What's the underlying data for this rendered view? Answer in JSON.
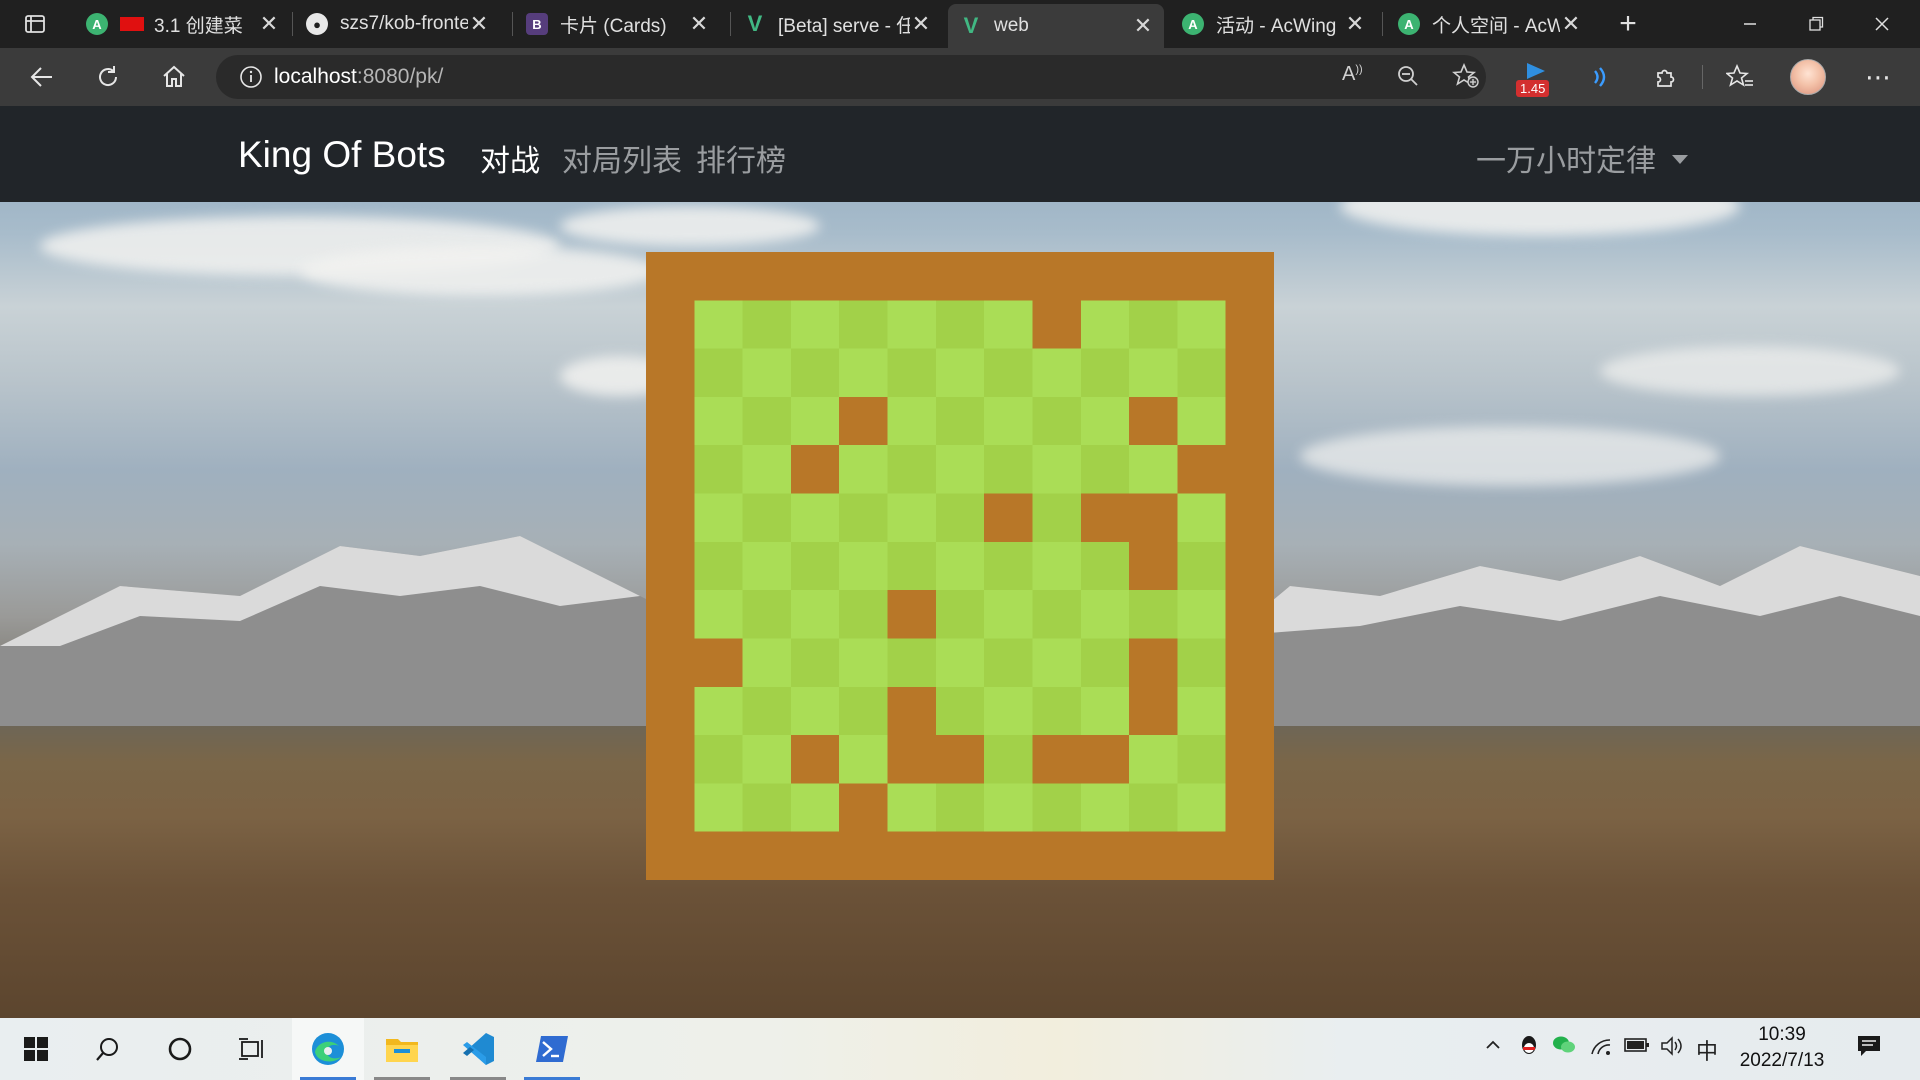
{
  "browser": {
    "tabs": [
      {
        "title": "3.1 创建菜",
        "favicon": "acwing-icon",
        "active": false
      },
      {
        "title": "szs7/kob-fronte",
        "favicon": "github-icon",
        "active": false
      },
      {
        "title": "卡片 (Cards)",
        "favicon": "bootstrap-icon",
        "active": false
      },
      {
        "title": "[Beta] serve - 任",
        "favicon": "vue-icon",
        "active": false
      },
      {
        "title": "web",
        "favicon": "vue-icon",
        "active": true
      },
      {
        "title": "活动 - AcWing",
        "favicon": "acwing-icon",
        "active": false
      },
      {
        "title": "个人空间 - AcW",
        "favicon": "acwing-icon",
        "active": false
      }
    ],
    "address": {
      "host": "localhost",
      "rest": ":8080/pk/"
    },
    "extension_badge": "1.45"
  },
  "app": {
    "brand": "King Of Bots",
    "nav": [
      {
        "label": "对战",
        "active": true
      },
      {
        "label": "对局列表",
        "active": false
      },
      {
        "label": "排行榜",
        "active": false
      }
    ],
    "user_menu": "一万小时定律"
  },
  "game_map": {
    "rows": 13,
    "cols": 13,
    "colors": {
      "wall": "#b87728",
      "grass_light": "#aadd56",
      "grass_dark": "#a2d149"
    },
    "walls": [
      [
        0,
        0
      ],
      [
        0,
        1
      ],
      [
        0,
        2
      ],
      [
        0,
        3
      ],
      [
        0,
        4
      ],
      [
        0,
        5
      ],
      [
        0,
        6
      ],
      [
        0,
        7
      ],
      [
        0,
        8
      ],
      [
        0,
        9
      ],
      [
        0,
        10
      ],
      [
        0,
        11
      ],
      [
        0,
        12
      ],
      [
        12,
        0
      ],
      [
        12,
        1
      ],
      [
        12,
        2
      ],
      [
        12,
        3
      ],
      [
        12,
        4
      ],
      [
        12,
        5
      ],
      [
        12,
        6
      ],
      [
        12,
        7
      ],
      [
        12,
        8
      ],
      [
        12,
        9
      ],
      [
        12,
        10
      ],
      [
        12,
        11
      ],
      [
        12,
        12
      ],
      [
        1,
        0
      ],
      [
        2,
        0
      ],
      [
        3,
        0
      ],
      [
        4,
        0
      ],
      [
        5,
        0
      ],
      [
        6,
        0
      ],
      [
        7,
        0
      ],
      [
        8,
        0
      ],
      [
        9,
        0
      ],
      [
        10,
        0
      ],
      [
        11,
        0
      ],
      [
        1,
        12
      ],
      [
        2,
        12
      ],
      [
        3,
        12
      ],
      [
        4,
        12
      ],
      [
        5,
        12
      ],
      [
        6,
        12
      ],
      [
        7,
        12
      ],
      [
        8,
        12
      ],
      [
        9,
        12
      ],
      [
        10,
        12
      ],
      [
        11,
        12
      ],
      [
        1,
        8
      ],
      [
        3,
        4
      ],
      [
        3,
        10
      ],
      [
        4,
        3
      ],
      [
        4,
        11
      ],
      [
        5,
        7
      ],
      [
        5,
        9
      ],
      [
        5,
        10
      ],
      [
        6,
        10
      ],
      [
        7,
        5
      ],
      [
        8,
        1
      ],
      [
        8,
        10
      ],
      [
        9,
        5
      ],
      [
        9,
        10
      ],
      [
        10,
        3
      ],
      [
        10,
        5
      ],
      [
        10,
        6
      ],
      [
        10,
        8
      ],
      [
        10,
        9
      ],
      [
        11,
        4
      ]
    ]
  },
  "taskbar": {
    "time": "10:39",
    "date": "2022/7/13",
    "ime": "中"
  }
}
